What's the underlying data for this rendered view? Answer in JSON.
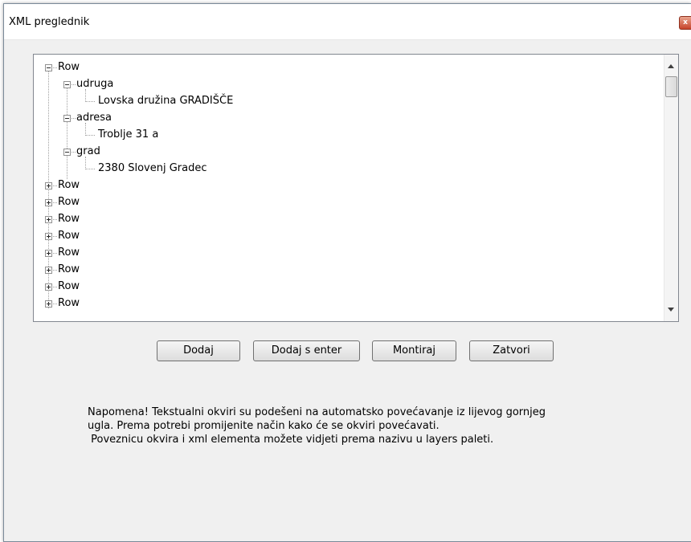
{
  "window": {
    "title": "XML preglednik",
    "close_icon": "close-icon"
  },
  "tree": {
    "root": {
      "label": "Row",
      "expanded": true
    },
    "children": [
      {
        "label": "udruga",
        "value": "Lovska družina GRADIŠČE"
      },
      {
        "label": "adresa",
        "value": "Troblje 31 a"
      },
      {
        "label": "grad",
        "value": "2380 Slovenj Gradec"
      }
    ],
    "collapsed_rows": [
      "Row",
      "Row",
      "Row",
      "Row",
      "Row",
      "Row",
      "Row",
      "Row"
    ]
  },
  "buttons": {
    "add": "Dodaj",
    "add_enter": "Dodaj s enter",
    "mount": "Montiraj",
    "close": "Zatvori"
  },
  "note": {
    "line1": "Napomena! Tekstualni okviri su podešeni na automatsko povećavanje iz lijevog gornjeg",
    "line2": "ugla. Prema potrebi promijenite način kako će se okviri povećavati.",
    "line3": " Poveznicu okvira i xml elementa možete vidjeti prema nazivu u layers paleti."
  }
}
